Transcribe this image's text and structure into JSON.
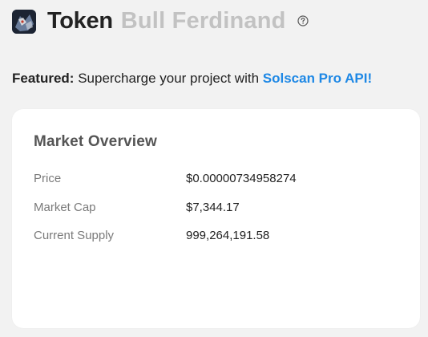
{
  "header": {
    "icon": "token-avatar-icon",
    "label": "Token",
    "name": "Bull Ferdinand",
    "help_icon": "question-circle-icon"
  },
  "featured": {
    "label": "Featured:",
    "text": " Supercharge your project with ",
    "link": "Solscan Pro API!",
    "link_color": "#1e88e5"
  },
  "market_overview": {
    "title": "Market Overview",
    "rows": [
      {
        "label": "Price",
        "value": "$0.00000734958274"
      },
      {
        "label": "Market Cap",
        "value": "$7,344.17"
      },
      {
        "label": "Current Supply",
        "value": "999,264,191.58"
      }
    ]
  }
}
